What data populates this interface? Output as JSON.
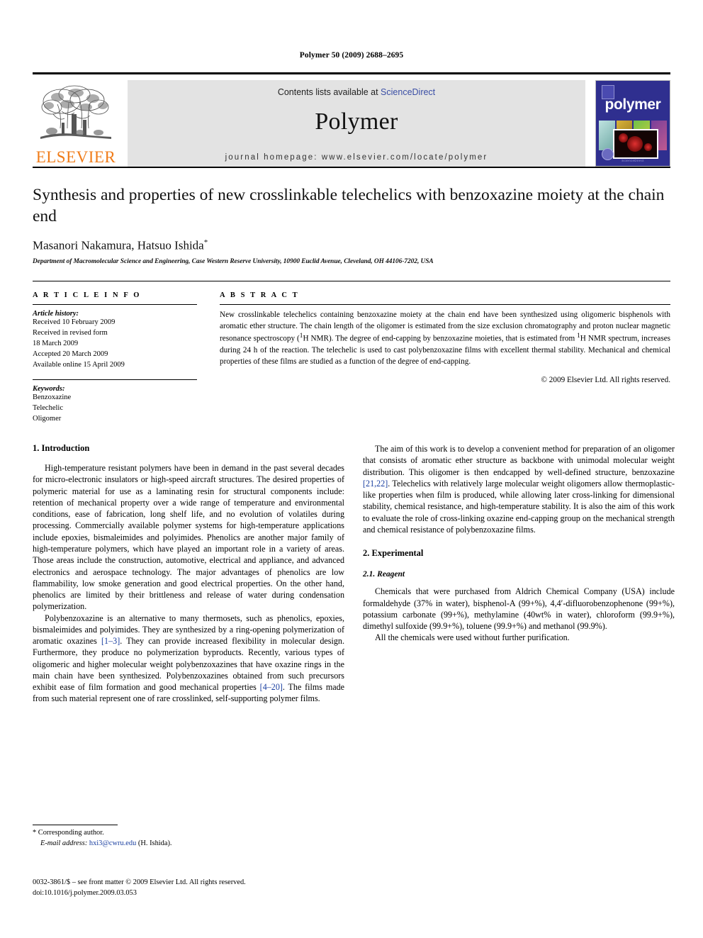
{
  "running_head": "Polymer 50 (2009) 2688–2695",
  "banner": {
    "publisher_name": "ELSEVIER",
    "contents_prefix": "Contents lists available at ",
    "sciencedirect": "ScienceDirect",
    "journal_name": "Polymer",
    "homepage": "journal homepage: www.elsevier.com/locate/polymer",
    "cover_title": "polymer",
    "cover_footer": "ScienceDirect",
    "accent_orange": "#F07C19",
    "link_blue": "#3a4ea5",
    "cover_blue": "#2f2f8f"
  },
  "article": {
    "title": "Synthesis and properties of new crosslinkable telechelics with benzoxazine moiety at the chain end",
    "authors": "Masanori Nakamura, Hatsuo Ishida",
    "author_note_mark": "*",
    "affiliation": "Department of Macromolecular Science and Engineering, Case Western Reserve University, 10900 Euclid Avenue, Cleveland, OH 44106-7202, USA"
  },
  "article_info": {
    "heading": "A R T I C L E   I N F O",
    "history_label": "Article history:",
    "history": [
      "Received 10 February 2009",
      "Received in revised form",
      "18 March 2009",
      "Accepted 20 March 2009",
      "Available online 15 April 2009"
    ],
    "keywords_label": "Keywords:",
    "keywords": [
      "Benzoxazine",
      "Telechelic",
      "Oligomer"
    ]
  },
  "abstract": {
    "heading": "A B S T R A C T",
    "body": "New crosslinkable telechelics containing benzoxazine moiety at the chain end have been synthesized using oligomeric bisphenols with aromatic ether structure. The chain length of the oligomer is estimated from the size exclusion chromatography and proton nuclear magnetic resonance spectroscopy (1H NMR). The degree of end-capping by benzoxazine moieties, that is estimated from 1H NMR spectrum, increases during 24 h of the reaction. The telechelic is used to cast polybenzoxazine films with excellent thermal stability. Mechanical and chemical properties of these films are studied as a function of the degree of end-capping.",
    "copyright": "© 2009 Elsevier Ltd. All rights reserved."
  },
  "sections": {
    "introduction_heading": "1. Introduction",
    "intro_p1": "High-temperature resistant polymers have been in demand in the past several decades for micro-electronic insulators or high-speed aircraft structures. The desired properties of polymeric material for use as a laminating resin for structural components include: retention of mechanical property over a wide range of temperature and environmental conditions, ease of fabrication, long shelf life, and no evolution of volatiles during processing. Commercially available polymer systems for high-temperature applications include epoxies, bismaleimides and polyimides. Phenolics are another major family of high-temperature polymers, which have played an important role in a variety of areas. Those areas include the construction, automotive, electrical and appliance, and advanced electronics and aerospace technology. The major advantages of phenolics are low flammability, low smoke generation and good electrical properties. On the other hand, phenolics are limited by their brittleness and release of water during condensation polymerization.",
    "intro_p2_a": "Polybenzoxazine is an alternative to many thermosets, such as phenolics, epoxies, bismaleimides and polyimides. They are synthesized by a ring-opening polymerization of aromatic oxazines ",
    "intro_p2_ref1": "[1–3]",
    "intro_p2_b": ". They can provide increased flexibility in molecular design. Furthermore, they produce no polymerization byproducts. Recently, various types of oligomeric and higher molecular weight polybenzoxazines that have oxazine rings in the main chain have been synthesized. Polybenzoxazines obtained from such precursors exhibit ease of film formation and good mechanical properties ",
    "intro_p2_ref2": "[4–20]",
    "intro_p2_c": ". The films made from such material represent one of rare crosslinked, self-supporting polymer films.",
    "intro_p3_a": "The aim of this work is to develop a convenient method for preparation of an oligomer that consists of aromatic ether structure as backbone with unimodal molecular weight distribution. This oligomer is then endcapped by well-defined structure, benzoxazine ",
    "intro_p3_ref": "[21,22]",
    "intro_p3_b": ". Telechelics with relatively large molecular weight oligomers allow thermoplastic-like properties when film is produced, while allowing later cross-linking for dimensional stability, chemical resistance, and high-temperature stability. It is also the aim of this work to evaluate the role of cross-linking oxazine end-capping group on the mechanical strength and chemical resistance of polybenzoxazine films.",
    "experimental_heading": "2. Experimental",
    "reagent_heading": "2.1. Reagent",
    "reagent_p1": "Chemicals that were purchased from Aldrich Chemical Company (USA) include formaldehyde (37% in water), bisphenol-A (99+%), 4,4′-difluorobenzophenone (99+%), potassium carbonate (99+%), methylamine (40wt% in water), chloroform (99.9+%), dimethyl sulfoxide (99.9+%), toluene (99.9+%) and methanol (99.9%).",
    "reagent_p2": "All the chemicals were used without further purification."
  },
  "footnote": {
    "corresponding": "* Corresponding author.",
    "email_label": "E-mail address:",
    "email": "hxi3@cwru.edu",
    "email_suffix": "(H. Ishida)."
  },
  "bottom_matter": {
    "issn_line": "0032-3861/$ – see front matter © 2009 Elsevier Ltd. All rights reserved.",
    "doi_line": "doi:10.1016/j.polymer.2009.03.053"
  }
}
